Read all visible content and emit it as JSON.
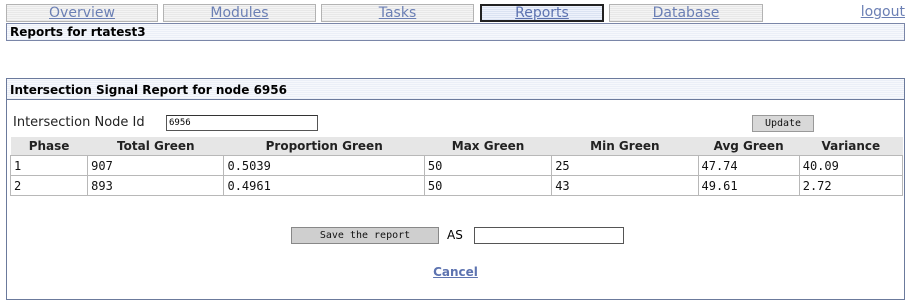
{
  "nav": {
    "tabs": [
      {
        "label": "Overview"
      },
      {
        "label": "Modules"
      },
      {
        "label": "Tasks"
      },
      {
        "label": "Reports",
        "active": true
      },
      {
        "label": "Database"
      }
    ],
    "logout_label": "logout"
  },
  "reports_bar": {
    "title": "Reports for rtatest3"
  },
  "panel": {
    "title": "Intersection Signal Report for node 6956",
    "node_label": "Intersection Node Id",
    "node_value": "6956",
    "update_label": "Update",
    "table": {
      "columns": [
        "Phase",
        "Total Green",
        "Proportion Green",
        "Max Green",
        "Min Green",
        "Avg Green",
        "Variance"
      ],
      "rows": [
        [
          "1",
          "907",
          "0.5039",
          "50",
          "25",
          "47.74",
          "40.09"
        ],
        [
          "2",
          "893",
          "0.4961",
          "50",
          "43",
          "49.61",
          "2.72"
        ]
      ]
    },
    "save_label": "Save the report",
    "as_label": "AS",
    "as_value": "",
    "cancel_label": "Cancel"
  },
  "colors": {
    "link": "#6b7fb4",
    "border": "#6b7a9c",
    "header_bg": "#e6e6e6"
  }
}
